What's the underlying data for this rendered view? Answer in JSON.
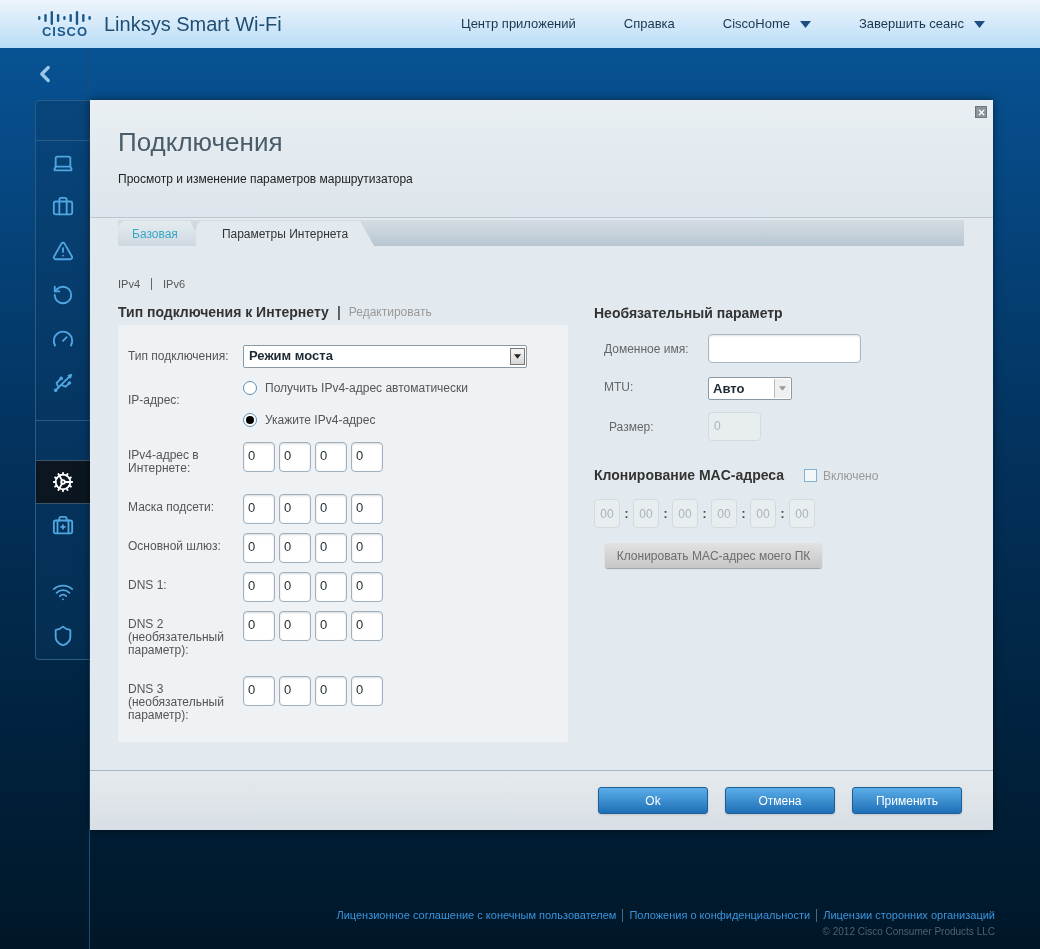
{
  "header": {
    "logo": "CISCO",
    "product": "Linksys Smart Wi-Fi",
    "nav": [
      {
        "label": "Центр приложений",
        "dropdown": false
      },
      {
        "label": "Справка",
        "dropdown": false
      },
      {
        "label": "CiscoHome",
        "dropdown": true
      },
      {
        "label": "Завершить сеанс",
        "dropdown": true
      }
    ]
  },
  "sidebar": {
    "items": [
      {
        "kind": "devices",
        "selected": false
      },
      {
        "kind": "guest",
        "selected": false
      },
      {
        "kind": "parental",
        "selected": false
      },
      {
        "kind": "media",
        "selected": false
      },
      {
        "kind": "speed",
        "selected": false
      },
      {
        "kind": "usb",
        "selected": false
      },
      {
        "kind": "settings",
        "selected": true
      },
      {
        "kind": "troubleshoot",
        "selected": false
      },
      {
        "kind": "wireless",
        "selected": false
      },
      {
        "kind": "security",
        "selected": false
      }
    ]
  },
  "dialog": {
    "title": "Подключения",
    "subtitle": "Просмотр и изменение параметров маршрутизатора",
    "tabs": [
      {
        "label": "Базовая",
        "selected": false
      },
      {
        "label": "Параметры Интернета",
        "selected": true
      }
    ],
    "ip_versions": [
      {
        "label": "IPv4"
      },
      {
        "label": "IPv6"
      }
    ],
    "connection": {
      "heading": "Тип подключения к Интернету",
      "separator": "|",
      "edit_link": "Редактировать",
      "type_label": "Тип подключения:",
      "type_value": "Режим моста",
      "ip_label": "IP-адрес:",
      "ip_options": [
        {
          "label": "Получить IPv4-адрес автоматически",
          "selected": false
        },
        {
          "label": "Укажите IPv4-адрес",
          "selected": true
        }
      ],
      "address_rows": [
        {
          "label": "IPv4-адрес в Интернете:",
          "octets": [
            "0",
            "0",
            "0",
            "0"
          ]
        },
        {
          "label": "Маска подсети:",
          "octets": [
            "0",
            "0",
            "0",
            "0"
          ]
        },
        {
          "label": "Основной шлюз:",
          "octets": [
            "0",
            "0",
            "0",
            "0"
          ]
        },
        {
          "label": "DNS 1:",
          "octets": [
            "0",
            "0",
            "0",
            "0"
          ]
        },
        {
          "label": "DNS 2 (необязательный параметр):",
          "octets": [
            "0",
            "0",
            "0",
            "0"
          ]
        },
        {
          "label": "DNS 3 (необязательный параметр):",
          "octets": [
            "0",
            "0",
            "0",
            "0"
          ]
        }
      ]
    },
    "optional": {
      "heading": "Необязательный параметр",
      "domain_label": "Доменное имя:",
      "mtu_label": "MTU:",
      "mtu_value": "Авто",
      "size_label": "Размер:",
      "size_value": "0"
    },
    "mac_clone": {
      "heading": "Клонирование MAC-адреса",
      "enabled_label": "Включено",
      "checked": false,
      "octets": [
        "00",
        "00",
        "00",
        "00",
        "00",
        "00"
      ],
      "separator": ":",
      "clone_button": "Клонировать MAC-адрес моего ПК"
    },
    "buttons": [
      "Ok",
      "Отмена",
      "Применить"
    ]
  },
  "footer": {
    "links": [
      "Лицензионное соглашение с конечным пользователем",
      "Положения о конфиденциальности",
      "Лицензии сторонних организаций"
    ],
    "copyright": "© 2012 Cisco Consumer Products LLC"
  }
}
